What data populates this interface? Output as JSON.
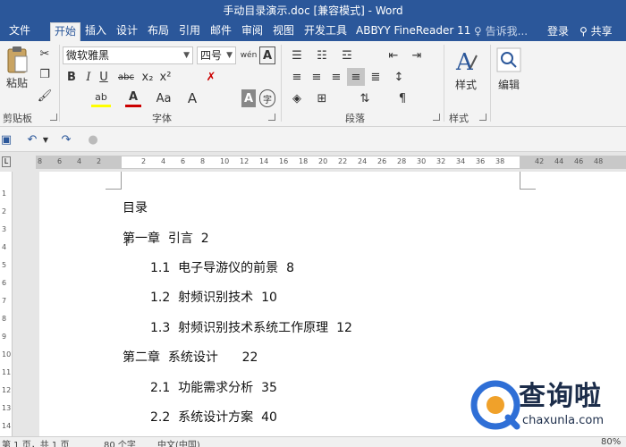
{
  "window": {
    "title": "手动目录演示.doc [兼容模式] - Word"
  },
  "tabs": [
    "文件",
    "开始",
    "插入",
    "设计",
    "布局",
    "引用",
    "邮件",
    "审阅",
    "视图",
    "开发工具",
    "ABBYY FineReader 11"
  ],
  "active_tab": "开始",
  "tell_me": "告诉我...",
  "login": "登录",
  "share": "共享",
  "ribbon": {
    "clipboard": {
      "label": "剪贴板",
      "paste": "粘贴"
    },
    "font": {
      "label": "字体",
      "font_name": "微软雅黑",
      "font_size": "四号",
      "bold": "B",
      "italic": "I",
      "underline": "U",
      "strike": "abc",
      "sub": "x₂",
      "sup": "x²",
      "highlight": "ab",
      "font_color": "A",
      "case": "Aa",
      "grow": "A",
      "char_shade": "A",
      "char_border": "A",
      "enclose": "字",
      "phonetic": "wén"
    },
    "paragraph": {
      "label": "段落"
    },
    "styles": {
      "label": "样式",
      "styles_btn": "样式"
    },
    "editing": {
      "label": "编辑",
      "editing_btn": "编辑"
    }
  },
  "ruler": {
    "h_ticks": [
      "8",
      "6",
      "4",
      "2",
      "2",
      "4",
      "6",
      "8",
      "10",
      "12",
      "14",
      "16",
      "18",
      "20",
      "22",
      "24",
      "26",
      "28",
      "30",
      "32",
      "34",
      "36",
      "38",
      "42",
      "44",
      "46",
      "48"
    ],
    "v_ticks": [
      "1",
      "2",
      "3",
      "4",
      "5",
      "6",
      "7",
      "8",
      "9",
      "10",
      "11",
      "12",
      "13",
      "14"
    ]
  },
  "document": {
    "toc": [
      {
        "text": "目录",
        "level": 0
      },
      {
        "text": "第一章  引言  2",
        "level": 0
      },
      {
        "text": "1.1  电子导游仪的前景  8",
        "level": 1
      },
      {
        "text": "1.2  射频识别技术  10",
        "level": 1
      },
      {
        "text": "1.3  射频识别技术系统工作原理  12",
        "level": 1
      },
      {
        "text": "第二章  系统设计      22",
        "level": 0
      },
      {
        "text": "2.1  功能需求分析  35",
        "level": 1
      },
      {
        "text": "2.2  系统设计方案  40",
        "level": 1
      }
    ]
  },
  "status": {
    "page": "第 1 页，共 1 页",
    "words": "80 个字",
    "lang": "中文(中国)",
    "zoom": "80%"
  },
  "watermark": {
    "brand": "查询啦",
    "url": "chaxunla.com"
  }
}
